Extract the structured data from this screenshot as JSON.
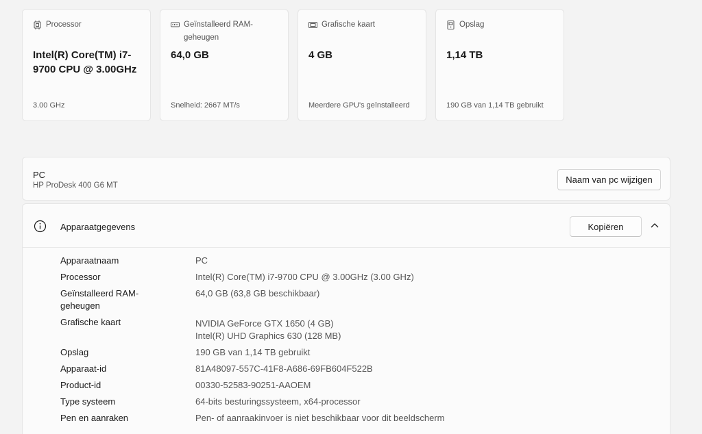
{
  "cards": [
    {
      "icon": "processor-icon",
      "title": "Processor",
      "value": "Intel(R) Core(TM) i7-9700 CPU @ 3.00GHz",
      "sub": "3.00 GHz"
    },
    {
      "icon": "ram-icon",
      "title": "Geïnstalleerd RAM-geheugen",
      "value": "64,0 GB",
      "sub": "Snelheid: 2667 MT/s"
    },
    {
      "icon": "graphics-card-icon",
      "title": "Grafische kaart",
      "value": "4 GB",
      "sub": "Meerdere GPU's geïnstalleerd"
    },
    {
      "icon": "storage-icon",
      "title": "Opslag",
      "value": "1,14 TB",
      "sub": "190 GB van 1,14 TB gebruikt"
    }
  ],
  "pc": {
    "name": "PC",
    "model": "HP ProDesk 400 G6 MT",
    "rename_label": "Naam van pc wijzigen"
  },
  "device": {
    "title": "Apparaatgegevens",
    "copy_label": "Kopiëren",
    "rows": [
      {
        "label": "Apparaatnaam",
        "value": "PC"
      },
      {
        "label": "Processor",
        "value": "Intel(R) Core(TM) i7-9700 CPU @ 3.00GHz (3.00 GHz)"
      },
      {
        "label": "Geïnstalleerd RAM-geheugen",
        "value": "64,0 GB (63,8 GB beschikbaar)"
      },
      {
        "label": "Grafische kaart",
        "value": "NVIDIA GeForce GTX 1650 (4 GB)",
        "value2": "Intel(R) UHD Graphics 630 (128 MB)"
      },
      {
        "label": "Opslag",
        "value": "190 GB van 1,14 TB gebruikt"
      },
      {
        "label": "Apparaat-id",
        "value": "81A48097-557C-41F8-A686-69FB604F522B"
      },
      {
        "label": "Product-id",
        "value": "00330-52583-90251-AAOEM"
      },
      {
        "label": "Type systeem",
        "value": "64-bits besturingssysteem, x64-processor"
      },
      {
        "label": "Pen en aanraken",
        "value": "Pen- of aanraakinvoer is niet beschikbaar voor dit beeldscherm"
      }
    ]
  }
}
